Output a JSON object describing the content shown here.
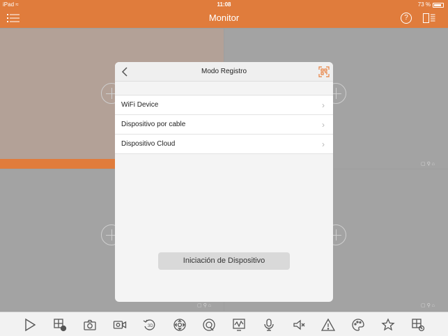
{
  "status_bar": {
    "device": "iPad",
    "time": "11:08",
    "battery": "73 %"
  },
  "nav": {
    "title": "Monitor"
  },
  "help": {
    "symbol": "?"
  },
  "modal": {
    "title": "Modo Registro",
    "items": [
      {
        "label": "WiFi Device"
      },
      {
        "label": "Dispositivo por cable"
      },
      {
        "label": "Dispositivo Cloud"
      }
    ],
    "button_label": "Iniciación de Dispositivo"
  },
  "colors": {
    "accent": "#e07c3c",
    "accent_icon": "#e8803f"
  },
  "toolbar_icons": [
    "play-icon",
    "add-window-icon",
    "camera-icon",
    "record-video-icon",
    "playback-3d-icon",
    "ptz-icon",
    "fisheye-icon",
    "monitor-chart-icon",
    "microphone-icon",
    "speaker-mute-icon",
    "alarm-warning-icon",
    "color-palette-icon",
    "favorite-star-icon",
    "layout-settings-icon"
  ]
}
